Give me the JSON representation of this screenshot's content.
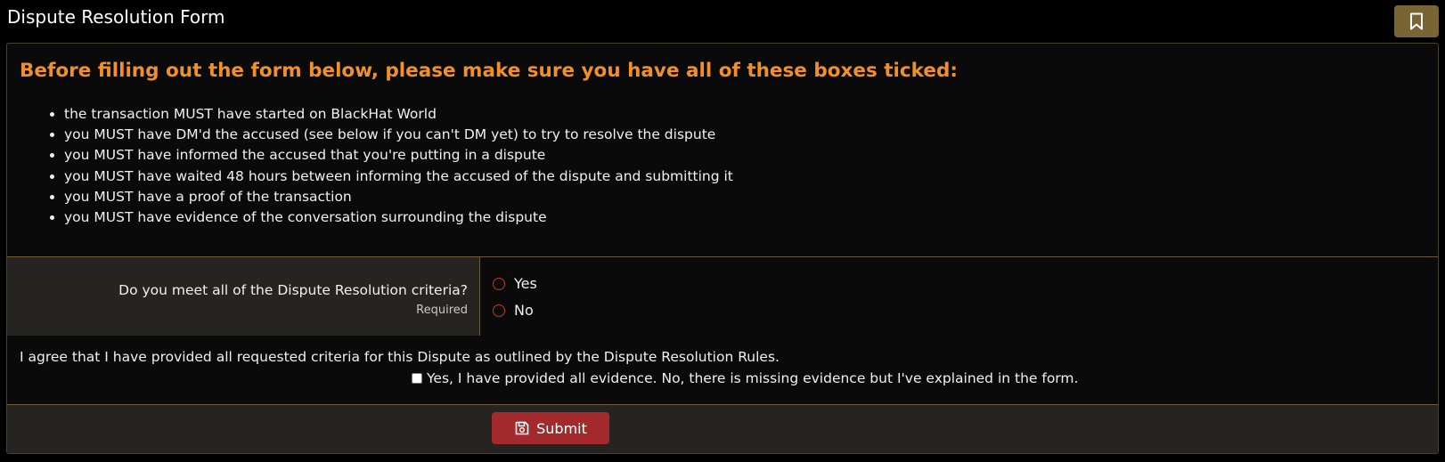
{
  "page": {
    "title": "Dispute Resolution Form"
  },
  "colors": {
    "accent_heading": "#f0902a",
    "bookmark_button": "#7a6434",
    "submit_button": "#a32a2c",
    "radio_border": "#c03b30",
    "divider": "#6b5a32"
  },
  "notice": {
    "heading": "Before filling out the form below, please make sure you have all of these boxes ticked:",
    "items": [
      "the transaction MUST have started on BlackHat World",
      "you MUST have DM'd the accused (see below if you can't DM yet) to try to resolve the dispute",
      "you MUST have informed the accused that you're putting in a dispute",
      "you MUST have waited 48 hours between informing the accused of the dispute and submitting it",
      "you MUST have a proof of the transaction",
      "you MUST have evidence of the conversation surrounding the dispute"
    ]
  },
  "question": {
    "label": "Do you meet all of the Dispute Resolution criteria?",
    "hint": "Required",
    "options": [
      "Yes",
      "No"
    ]
  },
  "agreement": {
    "text": "I agree that I have provided all requested criteria for this Dispute as outlined by the Dispute Resolution Rules.",
    "checkbox_label": "Yes, I have provided all evidence. No, there is missing evidence but I've explained in the form."
  },
  "footer": {
    "submit_label": "Submit"
  },
  "icons": {
    "bookmark": "bookmark-icon",
    "submit": "save-icon"
  }
}
